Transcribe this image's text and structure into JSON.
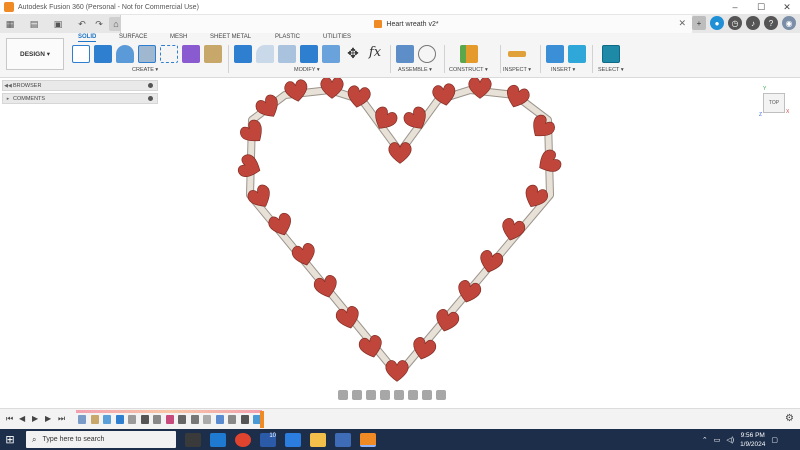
{
  "window": {
    "title": "Autodesk Fusion 360 (Personal - Not for Commercial Use)"
  },
  "document": {
    "tab_title": "Heart wreath v2*"
  },
  "workspace": {
    "label": "DESIGN ▾"
  },
  "tabs": [
    "SOLID",
    "SURFACE",
    "MESH",
    "SHEET METAL",
    "PLASTIC",
    "UTILITIES"
  ],
  "groups": [
    "CREATE ▾",
    "MODIFY ▾",
    "ASSEMBLE ▾",
    "CONSTRUCT ▾",
    "INSPECT ▾",
    "INSERT ▾",
    "SELECT ▾"
  ],
  "browser": {
    "browser_label": "BROWSER",
    "comments_label": "COMMENTS"
  },
  "viewcube": {
    "face": "TOP",
    "axis_z": "Z",
    "axis_x": "X",
    "axis_y": "Y"
  },
  "taskbar": {
    "search_placeholder": "Type here to search",
    "time": "9:56 PM",
    "date": "1/9/2024",
    "badge": "10"
  },
  "colors": {
    "heart_fill": "#c0453a",
    "rail": "#e8e1d8",
    "accent": "#1f74c4",
    "orange": "#f08a24"
  },
  "icons": [
    "grid-icon",
    "file-icon",
    "save-icon",
    "undo-icon",
    "redo-icon",
    "home-icon",
    "plus-icon",
    "bell-icon",
    "help-icon",
    "user-avatar"
  ]
}
